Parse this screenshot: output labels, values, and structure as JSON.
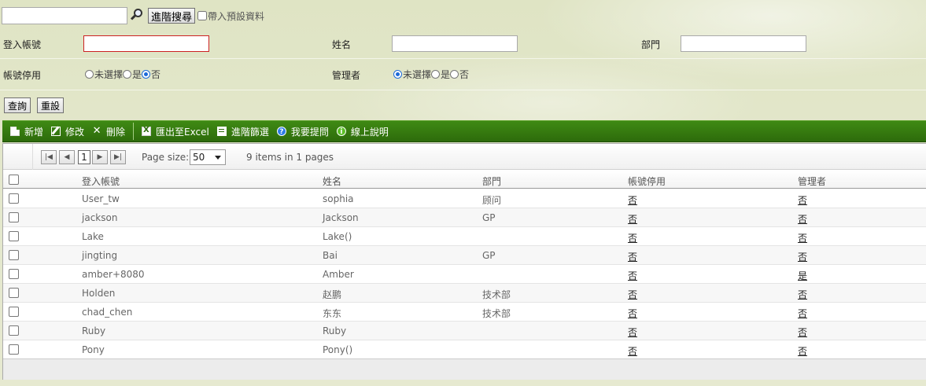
{
  "search": {
    "value": "",
    "advanced_button": "進階搜尋",
    "include_defaults_label": "帶入預設資料"
  },
  "filters": {
    "login_account_label": "登入帳號",
    "name_label": "姓名",
    "department_label": "部門",
    "account_disabled_label": "帳號停用",
    "admin_label": "管理者",
    "login_account_value": "",
    "name_value": "",
    "department_value": "",
    "radio_options": [
      "未選擇",
      "是",
      "否"
    ],
    "account_disabled_selected": "否",
    "admin_selected": "未選擇"
  },
  "actions": {
    "query": "查詢",
    "reset": "重設"
  },
  "toolbar": {
    "new": "新增",
    "edit": "修改",
    "delete": "刪除",
    "export_excel": "匯出至Excel",
    "advanced_filter": "進階篩選",
    "ask_question": "我要提問",
    "online_help": "線上說明"
  },
  "pager": {
    "current_page": "1",
    "page_size_label": "Page size:",
    "page_size": "50",
    "summary": "9 items in 1 pages"
  },
  "table": {
    "columns": [
      "登入帳號",
      "姓名",
      "部門",
      "帳號停用",
      "管理者"
    ],
    "rows": [
      {
        "account": "User_tw",
        "name": "sophia",
        "dept": "顾问",
        "disabled": "否",
        "admin": "否"
      },
      {
        "account": "jackson",
        "name": "Jackson",
        "dept": "GP",
        "disabled": "否",
        "admin": "否"
      },
      {
        "account": "Lake",
        "name": "Lake()",
        "dept": "",
        "disabled": "否",
        "admin": "否"
      },
      {
        "account": "jingting",
        "name": "Bai",
        "dept": "GP",
        "disabled": "否",
        "admin": "否"
      },
      {
        "account": "amber+8080",
        "name": "Amber",
        "dept": "",
        "disabled": "否",
        "admin": "是"
      },
      {
        "account": "Holden",
        "name": "赵鹏",
        "dept": "技术部",
        "disabled": "否",
        "admin": "否"
      },
      {
        "account": "chad_chen",
        "name": "东东",
        "dept": "技术部",
        "disabled": "否",
        "admin": "否"
      },
      {
        "account": "Ruby",
        "name": "Ruby",
        "dept": "",
        "disabled": "否",
        "admin": "否"
      },
      {
        "account": "Pony",
        "name": "Pony()",
        "dept": "",
        "disabled": "否",
        "admin": "否"
      }
    ]
  },
  "colors": {
    "toolbar_green": "#3f8a14",
    "form_background": "#e7ead2",
    "required_border": "#cc2222"
  }
}
